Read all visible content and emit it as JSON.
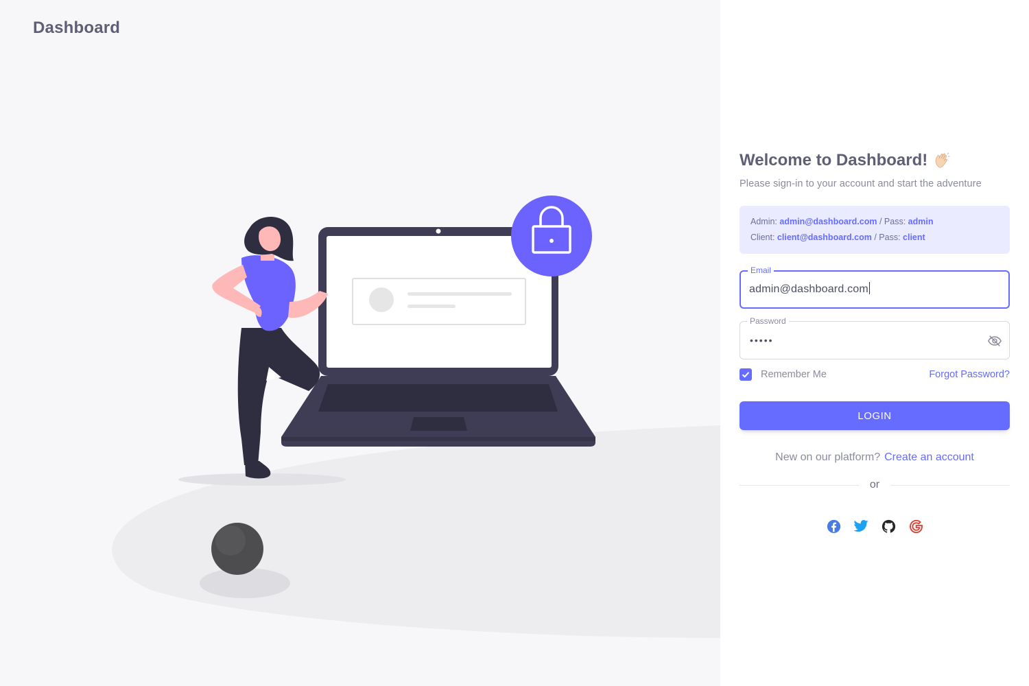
{
  "brand": {
    "name": "Dashboard"
  },
  "login": {
    "title": "Welcome to Dashboard!",
    "title_icon": "waving-hand-icon",
    "subtitle": "Please sign-in to your account and start the adventure",
    "credentials": {
      "admin_label": "Admin:",
      "admin_email": "admin@dashboard.com",
      "admin_sep": "/ Pass:",
      "admin_pass": "admin",
      "client_label": "Client:",
      "client_email": "client@dashboard.com",
      "client_sep": "/ Pass:",
      "client_pass": "client"
    },
    "email": {
      "label": "Email",
      "value": "admin@dashboard.com"
    },
    "password": {
      "label": "Password",
      "masked_value": "•••••",
      "toggle_icon": "eye-off-icon"
    },
    "remember_me": {
      "label": "Remember Me",
      "checked": true
    },
    "forgot_password": "Forgot Password?",
    "login_button": "LOGIN",
    "signup_prompt": "New on our platform?",
    "signup_link": "Create an account",
    "divider_text": "or",
    "social": [
      {
        "name": "facebook-icon",
        "color": "#497ce2"
      },
      {
        "name": "twitter-icon",
        "color": "#1da1f2"
      },
      {
        "name": "github-icon",
        "color": "#272727"
      },
      {
        "name": "google-icon",
        "color": "#db4437"
      }
    ]
  },
  "colors": {
    "primary": "#666cff",
    "background": "#f7f7f9",
    "text": "#4c4e64",
    "muted": "#8a8b9c",
    "credential_bg": "#ebebff"
  }
}
